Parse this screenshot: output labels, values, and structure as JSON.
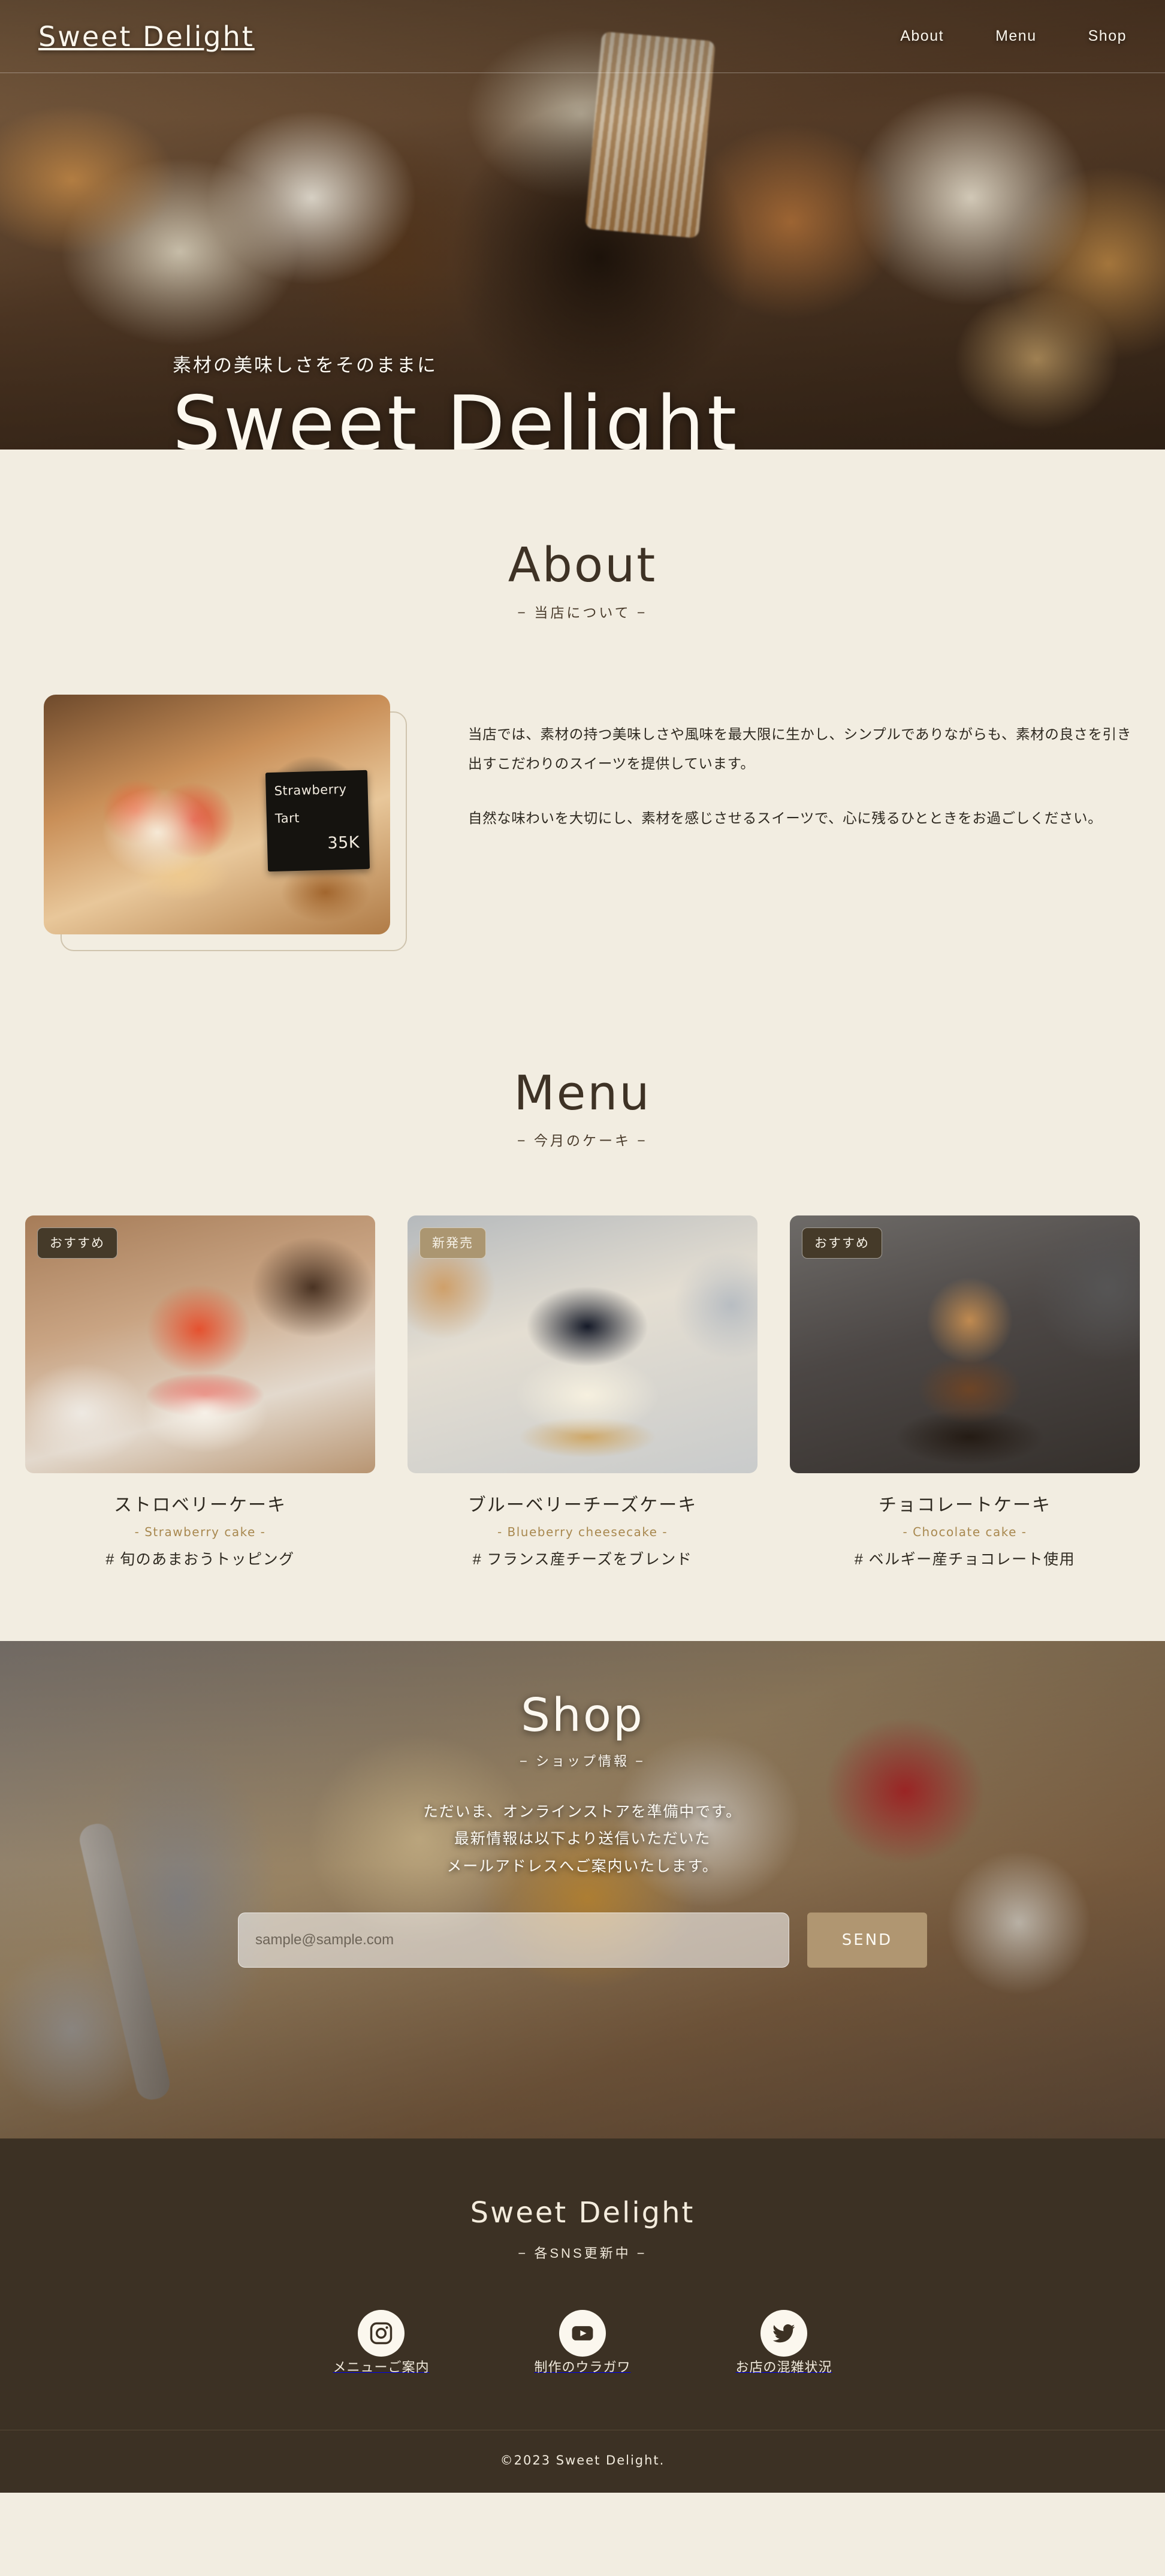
{
  "colors": {
    "page_bg": "#f2ede1",
    "text_dark": "#2e2920",
    "heading": "#3e3225",
    "accent_tan": "#b09671",
    "accent_gold": "#a8884f",
    "footer_bg": "#3c3124",
    "badge_dark": "#453a29",
    "badge_tan": "#ab9671",
    "cream": "#fcf8ef"
  },
  "header": {
    "brand": "Sweet Delight",
    "nav": [
      {
        "label": "About"
      },
      {
        "label": "Menu"
      },
      {
        "label": "Shop"
      }
    ]
  },
  "hero": {
    "tagline": "素材の美味しさをそのままに",
    "title": "Sweet Delight"
  },
  "about": {
    "title": "About",
    "subtitle": "− 当店について −",
    "image": {
      "board_name": "Strawberry\nTart",
      "board_line1": "Strawberry",
      "board_line2": "Tart",
      "board_price": "35K"
    },
    "paragraphs": [
      "当店では、素材の持つ美味しさや風味を最大限に生かし、シンプルでありながらも、素材の良さを引き出すこだわりのスイーツを提供しています。",
      "自然な味わいを大切にし、素材を感じさせるスイーツで、心に残るひとときをお過ごしください。"
    ]
  },
  "menu": {
    "title": "Menu",
    "subtitle": "− 今月のケーキ −",
    "items": [
      {
        "badge": "おすすめ",
        "badge_style": "dark",
        "name": "ストロベリーケーキ",
        "name_en": "- Strawberry cake -",
        "tag": "# 旬のあまおうトッピング"
      },
      {
        "badge": "新発売",
        "badge_style": "tan",
        "name": "ブルーベリーチーズケーキ",
        "name_en": "- Blueberry cheesecake -",
        "tag": "# フランス産チーズをブレンド"
      },
      {
        "badge": "おすすめ",
        "badge_style": "dark",
        "name": "チョコレートケーキ",
        "name_en": "- Chocolate cake -",
        "tag": "# ベルギー産チョコレート使用"
      }
    ]
  },
  "shop": {
    "title": "Shop",
    "subtitle": "− ショップ情報 −",
    "lines": [
      "ただいま、オンラインストアを準備中です。",
      "最新情報は以下より送信いただいた",
      "メールアドレスへご案内いたします。"
    ],
    "email_placeholder": "sample@sample.com",
    "email_value": "",
    "send_label": "SEND"
  },
  "footer": {
    "brand": "Sweet Delight",
    "subtitle": "− 各SNS更新中 −",
    "socials": [
      {
        "icon": "instagram-icon",
        "label": "メニューご案内"
      },
      {
        "icon": "youtube-icon",
        "label": "制作のウラガワ"
      },
      {
        "icon": "twitter-icon",
        "label": "お店の混雑状況"
      }
    ],
    "copyright": "©2023 Sweet Delight."
  }
}
